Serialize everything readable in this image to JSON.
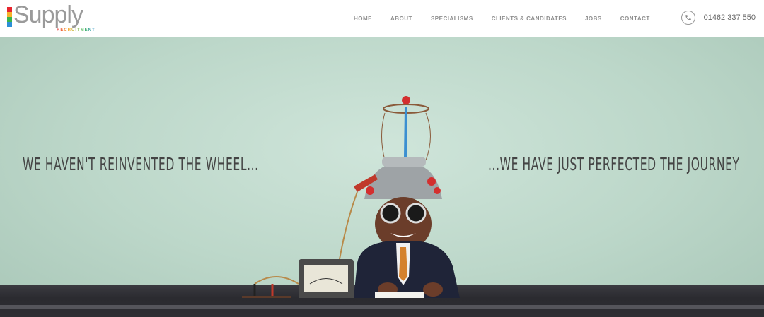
{
  "header": {
    "logo_text": "Supply",
    "logo_sub": "RECRUITMENT",
    "logo_colors": [
      "#e8262e",
      "#f7b32b",
      "#3bb54a",
      "#2c8fd6"
    ],
    "nav": [
      "HOME",
      "ABOUT",
      "SPECIALISMS",
      "CLIENTS & CANDIDATES",
      "JOBS",
      "CONTACT"
    ],
    "phone_icon": "phone-icon",
    "phone_number": "01462 337 550"
  },
  "hero": {
    "tagline_left": "WE HAVEN'T REINVENTED THE WHEEL...",
    "tagline_right": "...WE HAVE JUST PERFECTED THE JOURNEY"
  }
}
